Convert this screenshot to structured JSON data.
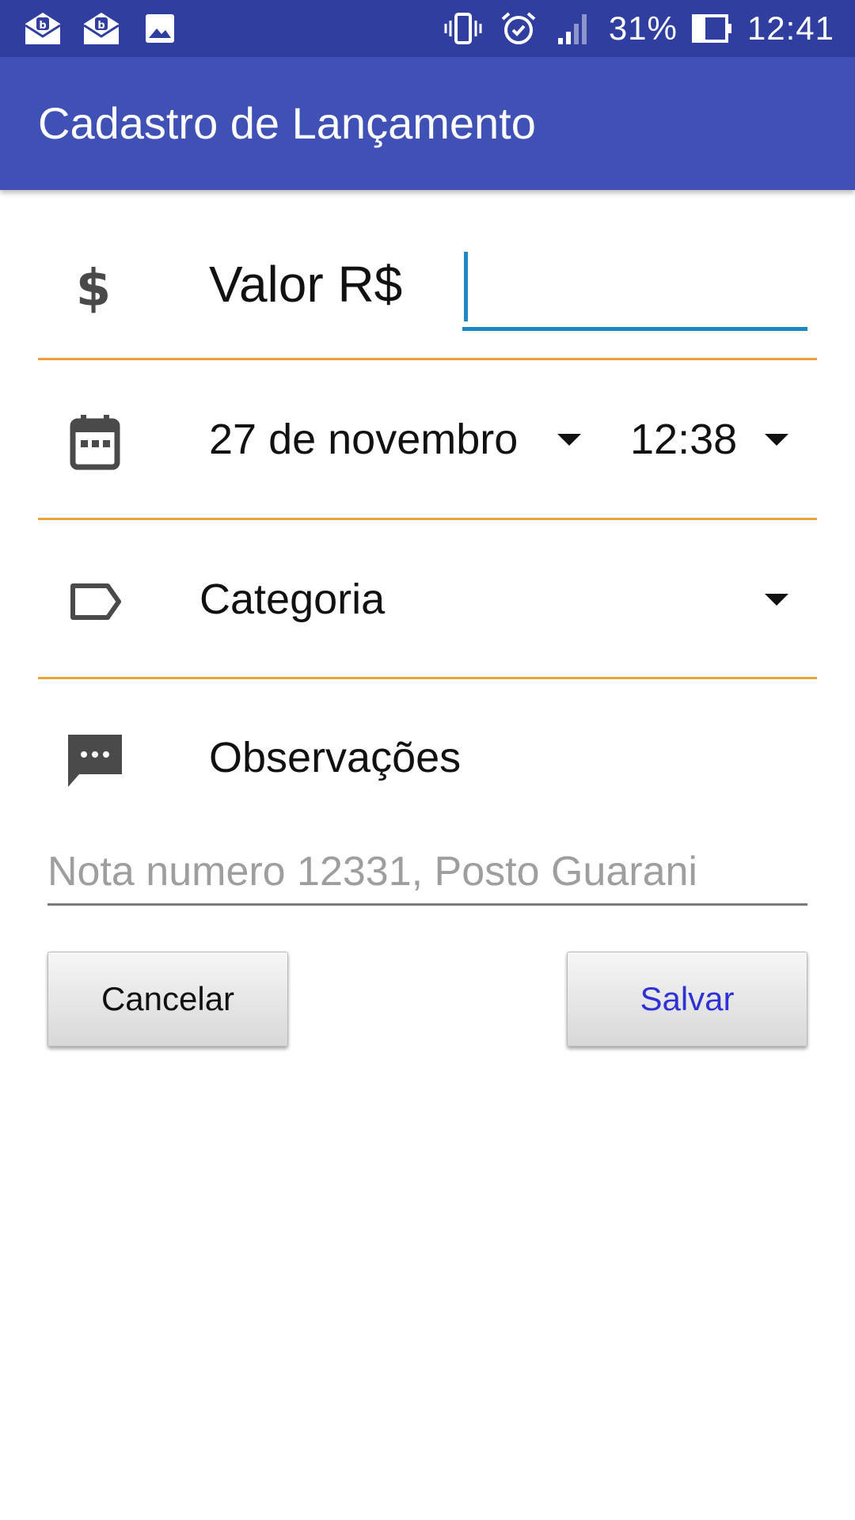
{
  "status_bar": {
    "battery": "31%",
    "time": "12:41",
    "icons_left": [
      "mail-b-icon",
      "mail-b-icon",
      "image-icon"
    ],
    "icons_right": [
      "vibrate-icon",
      "alarm-icon",
      "signal-icon",
      "battery-icon"
    ]
  },
  "app_bar": {
    "title": "Cadastro de Lançamento"
  },
  "form": {
    "value_label": "Valor  R$",
    "value_input": "",
    "date": "27 de novembro",
    "time": "12:38",
    "category": "Categoria",
    "observations_label": "Observações",
    "notes_placeholder": "Nota numero 12331, Posto Guarani",
    "notes_value": ""
  },
  "buttons": {
    "cancel": "Cancelar",
    "save": "Salvar"
  },
  "colors": {
    "status_bar": "#303f9f",
    "app_bar": "#3f51b5",
    "divider": "#e8a33a",
    "input_focus": "#1e88c5",
    "save_text": "#2f31d4",
    "icon_gray": "#4a4a4a"
  }
}
